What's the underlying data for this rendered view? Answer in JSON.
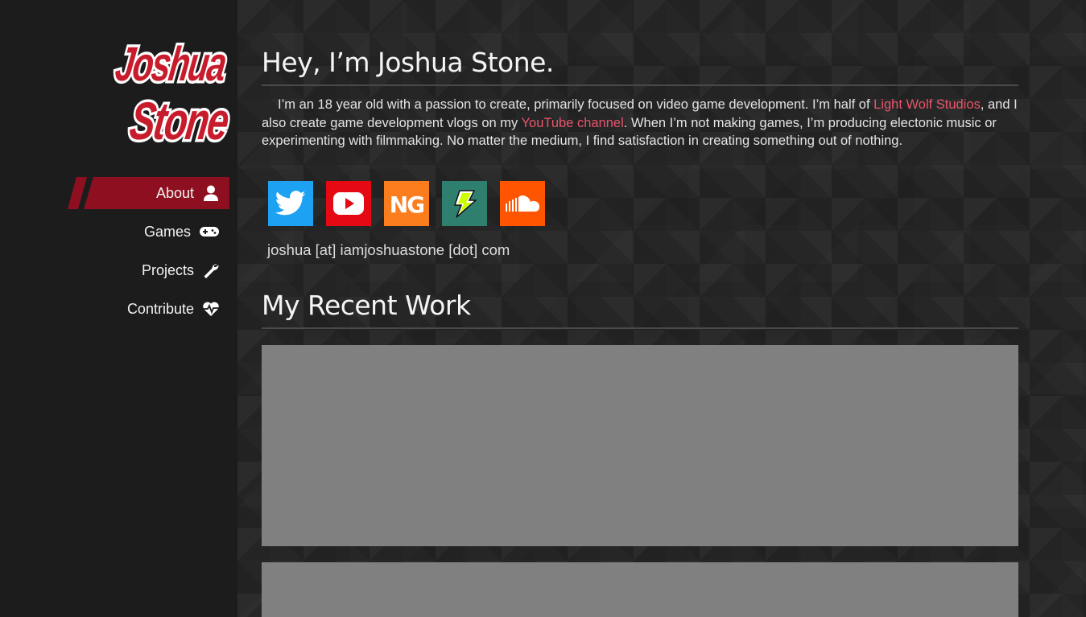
{
  "logo": {
    "line1": "Joshua",
    "line2": "Stone",
    "colors": {
      "fill": "#c81c2c",
      "outline": "#ffffff"
    }
  },
  "nav": {
    "items": [
      {
        "label": "About",
        "icon": "user-icon",
        "active": true
      },
      {
        "label": "Games",
        "icon": "gamepad-icon",
        "active": false
      },
      {
        "label": "Projects",
        "icon": "wrench-icon",
        "active": false
      },
      {
        "label": "Contribute",
        "icon": "heartbeat-icon",
        "active": false
      }
    ]
  },
  "intro": {
    "title": "Hey, I’m Joshua Stone.",
    "text_1": "I’m an 18 year old with a passion to create, primarily focused on video game development. I’m half of ",
    "link_1": "Light Wolf Studios",
    "text_2": ", and I also create game development vlogs on my ",
    "link_2": "YouTube channel",
    "text_3": ". When I’m not making games, I’m producing electonic music or experimenting with filmmaking. No matter the medium, I find satisfaction in creating something out of nothing."
  },
  "socials": [
    {
      "name": "twitter",
      "icon": "twitter-icon",
      "color": "#1da1f2"
    },
    {
      "name": "youtube",
      "icon": "youtube-icon",
      "color": "#e50914"
    },
    {
      "name": "newgrounds",
      "icon": "newgrounds-icon",
      "color": "#fb7d1d"
    },
    {
      "name": "gamejolt",
      "icon": "gamejolt-icon",
      "color": "#2f7f6f"
    },
    {
      "name": "soundcloud",
      "icon": "soundcloud-icon",
      "color": "#ff5500"
    }
  ],
  "email": "joshua [at] iamjoshuastone [dot] com",
  "recent": {
    "title": "My Recent Work"
  },
  "colors": {
    "accent": "#8e1020",
    "link": "#e8556a",
    "placeholder": "#808080"
  }
}
